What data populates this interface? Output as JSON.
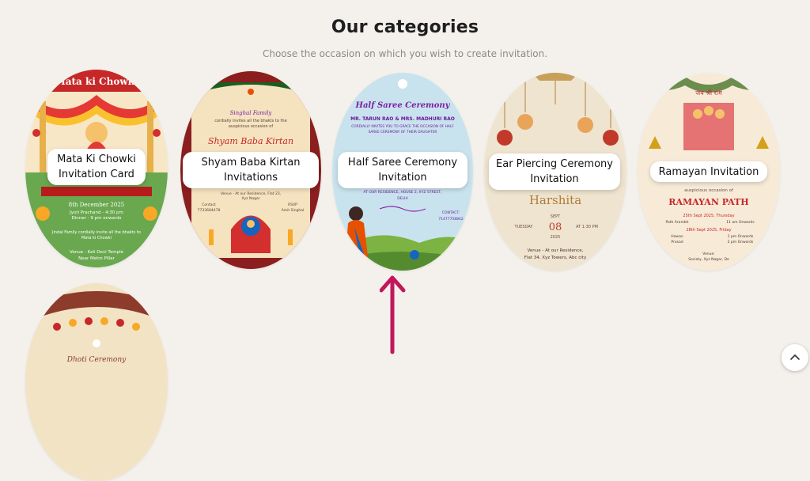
{
  "section": {
    "title": "Our categories",
    "subtitle": "Choose the occasion on which you wish to create invitation."
  },
  "cards": [
    {
      "label": "Mata Ki Chowki Invitation Card",
      "art": {
        "banner": "Mata ki Chowki",
        "date": "8th December 2025",
        "line1": "Jyoti Prachand - 4:30 pm",
        "line2": "Dinner - 9 pm onwards",
        "line3": "Jindal Family cordially invite all the bhakts to",
        "line4": "Mata ki Chowki",
        "line5": "Venue - Kali Devi Temple",
        "line6": "Near Metro Pillar"
      }
    },
    {
      "label": "Shyam Baba Kirtan Invitations",
      "art": {
        "family": "Singhal Family",
        "line1": "cordially invites all the bhakts to the",
        "line2": "auspicious occasion of",
        "script": "Shyam Baba Kirtan",
        "venue": "Venue - At our Residence, Flat 23,",
        "venue2": "Xyz Nagar",
        "contact": "Contact",
        "phone": "7733684478",
        "rsvp": "RSVP",
        "rsvp_name": "Amit Singhal"
      }
    },
    {
      "label": "Half Saree Ceremony Invitation",
      "art": {
        "heading": "Half Saree Ceremony",
        "hosts": "MR. TARUN RAO & MRS. MADHURI RAO",
        "line1": "CORDIALLY INVITES YOU TO GRACE THE OCCASION OF HALF",
        "line2": "SAREE CEREMONY OF THEIR DAUGHTER",
        "venue": "AT OUR RESIDENCE, HOUSE 2, XYZ STREET,",
        "city": "DELHI",
        "contact": "CONTACT:",
        "phone": "71477758842"
      }
    },
    {
      "label": "Ear Piercing Ceremony Invitation",
      "art": {
        "name": "Harshita",
        "month": "SEPT",
        "day": "TUESDAY",
        "date": "08",
        "year": "2025",
        "time": "AT 1:30 PM",
        "venue": "Venue - At our Residence,",
        "venue2": "Flat 34, Xyz Towers, Abc city"
      }
    },
    {
      "label": "Ramayan Invitation",
      "art": {
        "top": "जय श्री राम",
        "sub": "auspicious occasion of",
        "heading": "RAMAYAN PATH",
        "date1": "25th Sept 2025, Thursday",
        "l1": "Path Arambh",
        "t1": "11 am Onwards",
        "date2": "28th Sept 2025, Friday",
        "l2": "Hawan",
        "t2": "1 pm Onwards",
        "l3": "Prasad",
        "t3": "2 pm Onwards",
        "venue": "Venue:",
        "venue2": "Society, Xyz Nagar, De"
      }
    },
    {
      "label": "",
      "art": {
        "heading": "Dhoti Ceremony"
      }
    }
  ],
  "colors": {
    "accent_arrow": "#c2185b",
    "background": "#f4f1ec"
  },
  "icons": {
    "scroll_top": "chevron-up-icon"
  }
}
